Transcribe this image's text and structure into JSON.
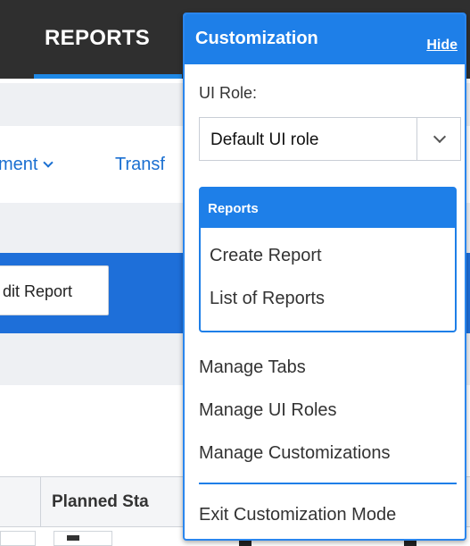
{
  "app": {
    "tab_reports": "REPORTS",
    "menu_items": [
      "ment",
      "Transf"
    ],
    "edit_report_button": "dit Report",
    "table": {
      "columns": [
        "Planned Sta"
      ]
    }
  },
  "panel": {
    "title": "Customization",
    "hide_link": "Hide",
    "ui_role_label": "UI Role:",
    "ui_role_selected": "Default UI role",
    "reports_section": {
      "title": "Reports",
      "items": [
        "Create Report",
        "List of Reports"
      ]
    },
    "items": [
      "Manage Tabs",
      "Manage UI Roles",
      "Manage Customizations"
    ],
    "exit_label": "Exit Customization Mode"
  },
  "colors": {
    "accent": "#1e7fe8",
    "topbar": "#2f2f2f",
    "link": "#1a6fd1"
  },
  "icons": {
    "role_dropdown": "chevron-down-icon",
    "menu_dropdown": "chevron-down-icon"
  }
}
